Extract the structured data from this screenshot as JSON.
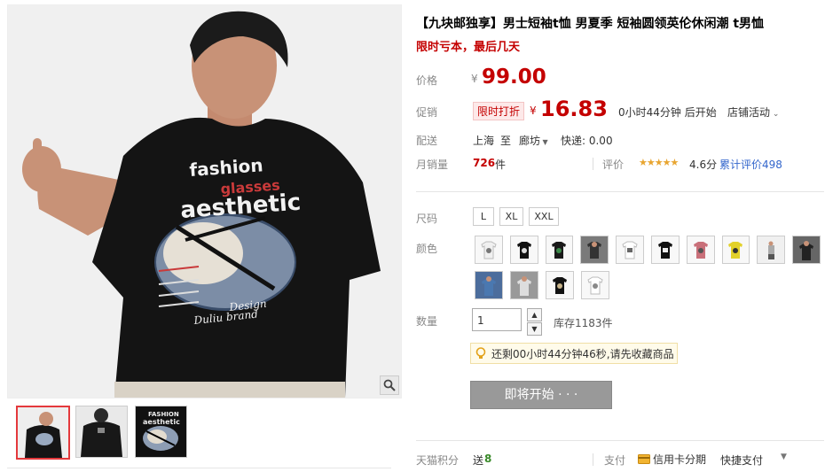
{
  "product": {
    "title": "【九块邮独享】男士短袖t恤 男夏季 短袖圆领英伦休闲潮 t男恤",
    "subtitle": "限时亏本，最后几天"
  },
  "image": {
    "shirt_text_1": "fashion",
    "shirt_text_2": "glasses",
    "shirt_text_3": "aesthetic",
    "shirt_text_4": "Design",
    "shirt_text_5": "Duliu brand",
    "zoom_icon": "magnifier-icon",
    "thumb3_text_1": "FASHION",
    "thumb3_text_2": "aesthetic"
  },
  "price": {
    "label": "价格",
    "currency": "¥",
    "value": "99.00"
  },
  "promo": {
    "label": "促销",
    "tag": "限时打折",
    "currency": "¥",
    "value": "16.83",
    "countdown": "0小时44分钟 后开始",
    "shop_activity": "店铺活动"
  },
  "delivery": {
    "label": "配送",
    "from": "上海",
    "to_word": "至",
    "dest": "廊坊",
    "express": "快递: 0.00"
  },
  "sales": {
    "label": "月销量",
    "count": "726",
    "unit": "件",
    "rating_label": "评价",
    "stars": "★★★★★",
    "score": "4.6分",
    "review_link": "累计评价498"
  },
  "size": {
    "label": "尺码",
    "options": [
      "L",
      "XL",
      "XXL"
    ]
  },
  "color": {
    "label": "颜色"
  },
  "quantity": {
    "label": "数量",
    "value": "1",
    "stock": "库存1183件"
  },
  "reminder": {
    "text": "还剩00小时44分钟46秒,请先收藏商品"
  },
  "buy_button": {
    "label": "即将开始 · · ·"
  },
  "footer": {
    "points_label": "天猫积分",
    "points_prefix": "送",
    "points_value": "8",
    "pay_label": "支付",
    "credit_card": "信用卡分期",
    "quick_pay": "快捷支付"
  },
  "colors": {
    "accent": "#c40000",
    "link": "#3366cc"
  }
}
